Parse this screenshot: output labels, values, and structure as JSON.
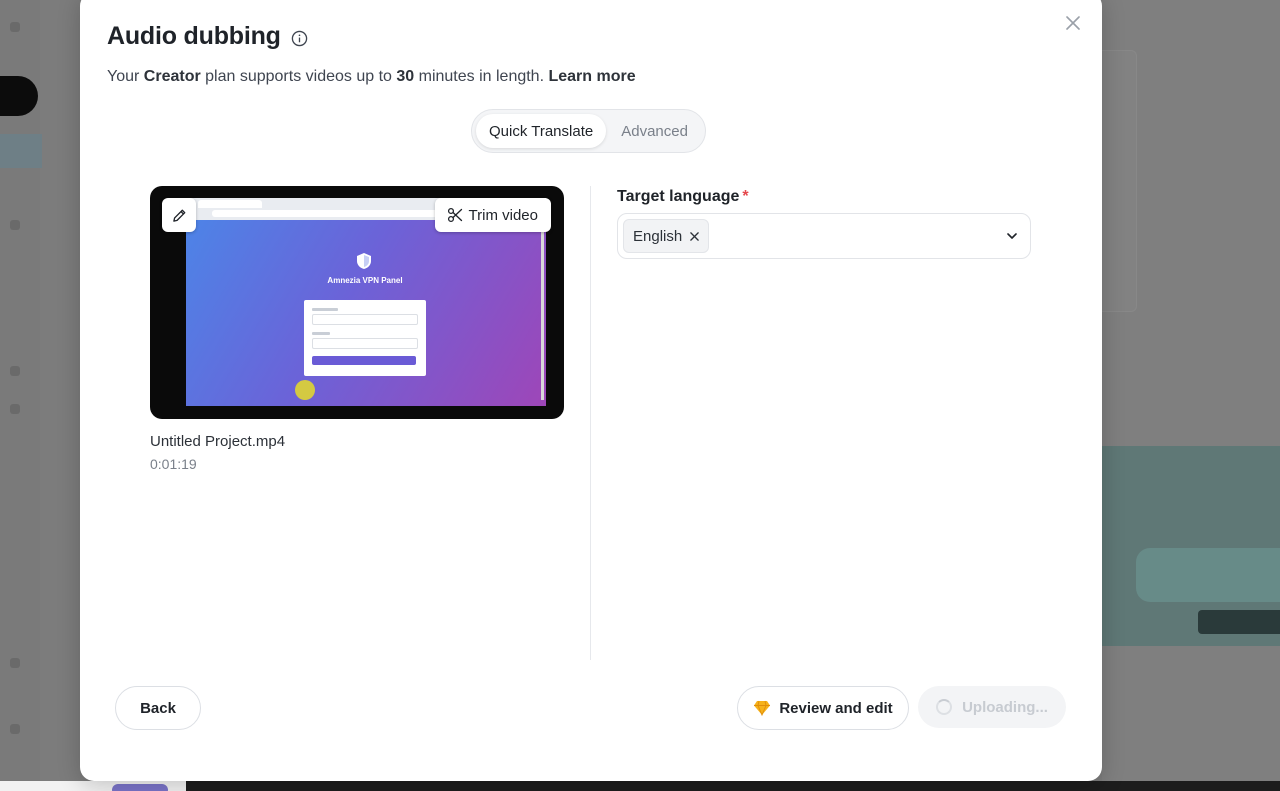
{
  "dialog": {
    "title": "Audio dubbing",
    "subtitle": {
      "prefix": "Your ",
      "plan": "Creator",
      "mid": " plan supports videos up to ",
      "limit": "30",
      "suffix": " minutes in length. ",
      "learn_more": "Learn more"
    },
    "modes": [
      {
        "label": "Quick Translate",
        "active": true
      },
      {
        "label": "Advanced",
        "active": false
      }
    ]
  },
  "video": {
    "trim_label": "Trim video",
    "file_name": "Untitled Project.mp4",
    "duration": "0:01:19",
    "thumbnail": {
      "title": "Amnezia VPN Panel"
    }
  },
  "target_language": {
    "label": "Target language",
    "required_mark": "*",
    "selected": [
      "English"
    ]
  },
  "footer": {
    "back_label": "Back",
    "review_label": "Review and edit",
    "upload_label": "Uploading..."
  },
  "icons": {
    "close": "close-icon",
    "info": "info-icon",
    "edit": "pencil-icon",
    "trim": "scissors-icon",
    "remove_chip": "x-icon",
    "dropdown": "chevron-down-icon",
    "review": "gem-icon",
    "loading": "spinner-icon"
  },
  "colors": {
    "required": "#e5484d",
    "gem": "#f6b21b",
    "thumb_gradient_start": "#4b86e8",
    "thumb_gradient_end": "#9e46b8"
  }
}
